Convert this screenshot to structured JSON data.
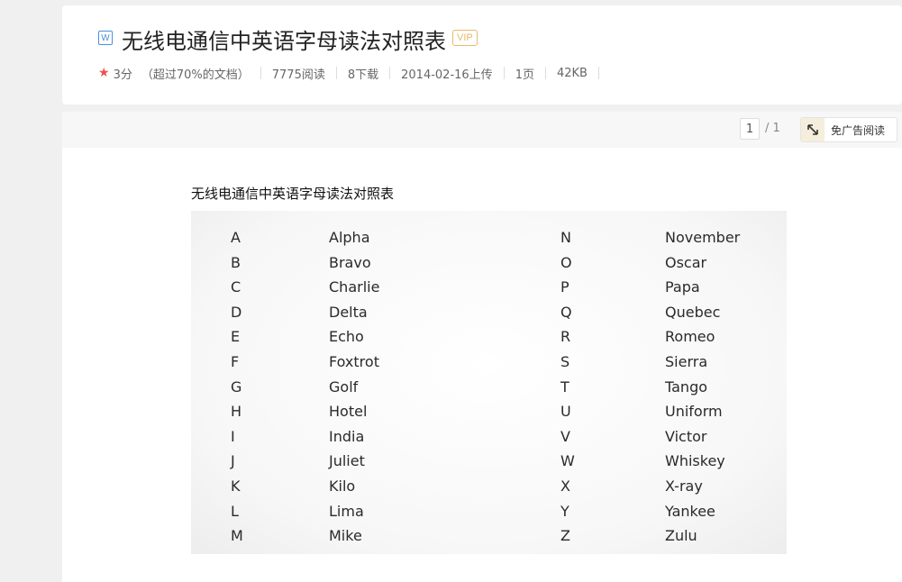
{
  "header": {
    "doc_type_icon": "W",
    "title": "无线电通信中英语字母读法对照表",
    "vip_badge": "VIP",
    "rating_icon": "star-icon",
    "rating": "3分",
    "rating_note": "（超过70%的文档）",
    "reads": "7775阅读",
    "downloads": "8下载",
    "upload_date": "2014-02-16上传",
    "pages": "1页",
    "file_size": "42KB"
  },
  "toolbar": {
    "current_page": "1",
    "total_pages": "/ 1",
    "ad_free_icon": "expand-icon",
    "ad_free_label": "免广告阅读"
  },
  "document": {
    "title": "无线电通信中英语字母读法对照表",
    "left_letters": [
      "A",
      "B",
      "C",
      "D",
      "E",
      "F",
      "G",
      "H",
      "I",
      "J",
      "K",
      "L",
      "M"
    ],
    "left_words": [
      "Alpha",
      "Bravo",
      "Charlie",
      "Delta",
      "Echo",
      "Foxtrot",
      "Golf",
      "Hotel",
      "India",
      "Juliet",
      "Kilo",
      "Lima",
      "Mike"
    ],
    "right_letters": [
      "N",
      "O",
      "P",
      "Q",
      "R",
      "S",
      "T",
      "U",
      "V",
      "W",
      "X",
      "Y",
      "Z"
    ],
    "right_words": [
      "November",
      "Oscar",
      "Papa",
      "Quebec",
      "Romeo",
      "Sierra",
      "Tango",
      "Uniform",
      "Victor",
      "Whiskey",
      "X-ray",
      "Yankee",
      "Zulu"
    ]
  }
}
